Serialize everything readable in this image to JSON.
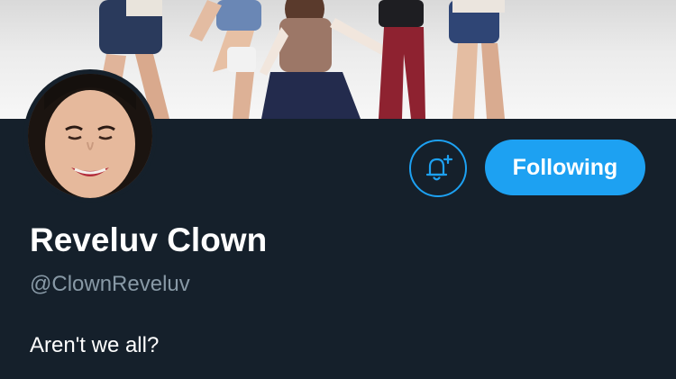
{
  "profile": {
    "display_name": "Reveluv Clown",
    "handle": "@ClownReveluv",
    "bio": "Aren't we all?"
  },
  "actions": {
    "follow_label": "Following",
    "notify_icon": "bell-plus-icon"
  },
  "colors": {
    "background": "#15202b",
    "accent": "#1da1f2",
    "secondary_text": "#8899a6",
    "primary_text": "#ffffff"
  }
}
